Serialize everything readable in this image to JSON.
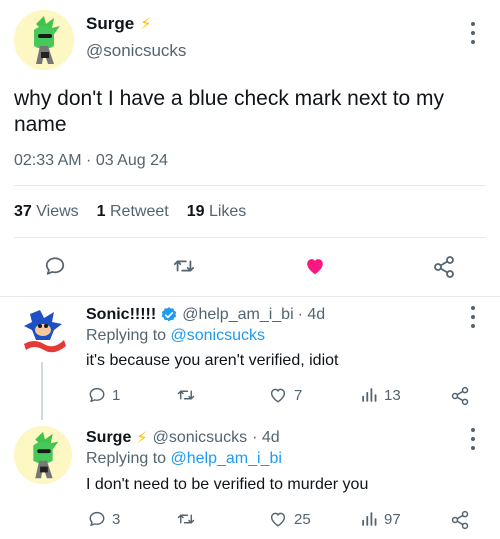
{
  "main_tweet": {
    "author_name": "Surge",
    "author_handle": "@sonicsucks",
    "text": "why don't I have a blue check mark next to my name",
    "timestamp": "02:33 AM · 03 Aug 24",
    "stats": {
      "views_count": "37",
      "views_label": "Views",
      "retweets_count": "1",
      "retweets_label": "Retweet",
      "likes_count": "19",
      "likes_label": "Likes"
    },
    "liked": true
  },
  "replies": [
    {
      "author_name": "Sonic!!!!!",
      "verified": true,
      "author_handle": "@help_am_i_bi",
      "age": "· 4d",
      "replying_prefix": "Replying to",
      "replying_to": "@sonicsucks",
      "text": "it's because you aren't verified, idiot",
      "replies_count": "1",
      "likes_count": "7",
      "views_count": "13"
    },
    {
      "author_name": "Surge",
      "verified": false,
      "author_handle": "@sonicsucks",
      "age": "· 4d",
      "replying_prefix": "Replying to",
      "replying_to": "@help_am_i_bi",
      "text": "I don't need to be verified to murder you",
      "replies_count": "3",
      "likes_count": "25",
      "views_count": "97"
    }
  ],
  "icons": {
    "more": "more-vertical-icon",
    "reply": "speech-bubble-icon",
    "retweet": "retweet-icon",
    "like": "heart-icon",
    "share": "share-icon",
    "views": "bar-chart-icon",
    "verified": "verified-badge-icon",
    "lightning": "lightning-bolt-icon"
  },
  "colors": {
    "accent": "#1d9bf0",
    "like_active": "#f91880",
    "muted": "#536471",
    "bolt": "#f4c20d"
  }
}
